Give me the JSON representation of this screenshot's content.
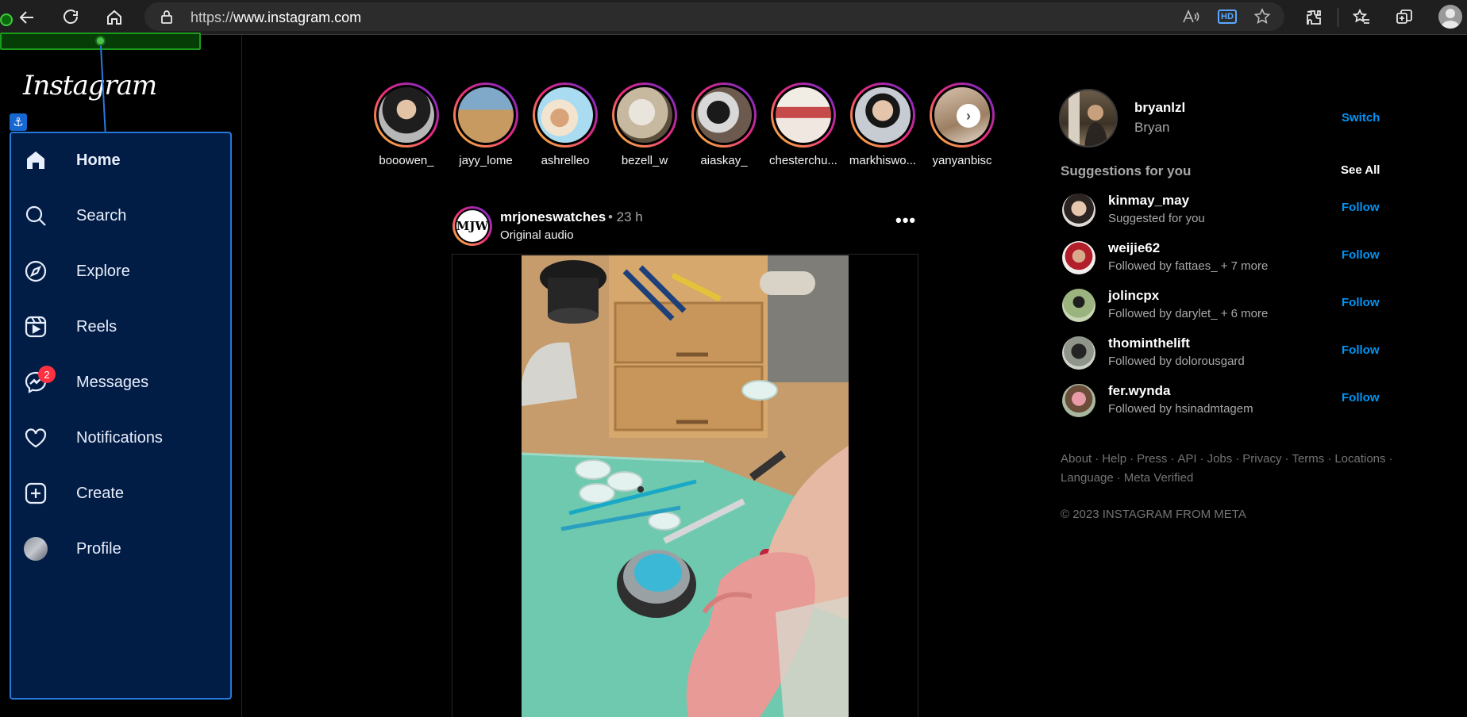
{
  "browser": {
    "url_prefix": "https://",
    "url_domain": "www.instagram.com"
  },
  "app": {
    "logo_text": "Instagram"
  },
  "nav": {
    "items": [
      {
        "label": "Home",
        "icon": "home-icon",
        "active": true
      },
      {
        "label": "Search",
        "icon": "search-icon"
      },
      {
        "label": "Explore",
        "icon": "compass-icon"
      },
      {
        "label": "Reels",
        "icon": "reels-icon"
      },
      {
        "label": "Messages",
        "icon": "messenger-icon",
        "badge": "2"
      },
      {
        "label": "Notifications",
        "icon": "heart-icon"
      },
      {
        "label": "Create",
        "icon": "plus-square-icon"
      },
      {
        "label": "Profile",
        "icon": "profile-avatar"
      }
    ]
  },
  "stories": [
    {
      "name": "booowen_"
    },
    {
      "name": "jayy_lome"
    },
    {
      "name": "ashrelleo"
    },
    {
      "name": "bezell_w"
    },
    {
      "name": "aiaskay_"
    },
    {
      "name": "chesterchu..."
    },
    {
      "name": "markhiswo..."
    },
    {
      "name": "yanyanbisc"
    }
  ],
  "post": {
    "username": "mrjoneswatches",
    "time": "• 23 h",
    "audio": "Original audio",
    "avatar_text": "MJW"
  },
  "me": {
    "username": "bryanlzl",
    "name": "Bryan",
    "switch_label": "Switch"
  },
  "suggestions": {
    "title": "Suggestions for you",
    "see_all": "See All",
    "follow_label": "Follow",
    "items": [
      {
        "username": "kinmay_may",
        "sub": "Suggested for you"
      },
      {
        "username": "weijie62",
        "sub": "Followed by fattaes_ + 7 more"
      },
      {
        "username": "jolincpx",
        "sub": "Followed by darylet_ + 6 more"
      },
      {
        "username": "thominthelift",
        "sub": "Followed by dolorousgard"
      },
      {
        "username": "fer.wynda",
        "sub": "Followed by hsinadmtagem"
      }
    ]
  },
  "footer": {
    "links": [
      "About",
      "Help",
      "Press",
      "API",
      "Jobs",
      "Privacy",
      "Terms",
      "Locations",
      "Language",
      "Meta Verified"
    ],
    "copyright": "© 2023 INSTAGRAM FROM META"
  },
  "colors": {
    "accent_link": "#0095f6",
    "nav_panel": "#021d45",
    "nav_panel_border": "#2379dc",
    "badge": "#ff3040"
  }
}
